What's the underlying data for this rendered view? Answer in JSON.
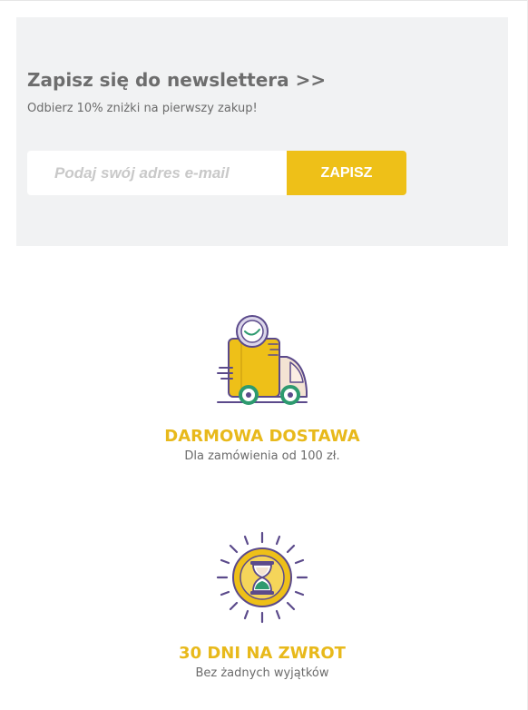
{
  "newsletter": {
    "title": "Zapisz się do newslettera >>",
    "subtitle": "Odbierz 10% zniżki na pierwszy zakup!",
    "email_placeholder": "Podaj swój adres e-mail",
    "email_value": "",
    "submit_label": "ZAPISZ"
  },
  "features": [
    {
      "icon": "delivery-truck-icon",
      "title": "DARMOWA DOSTAWA",
      "subtitle": "Dla zamówienia od 100 zł."
    },
    {
      "icon": "hourglass-icon",
      "title": "30 DNI NA ZWROT",
      "subtitle": "Bez żadnych wyjątków"
    }
  ],
  "colors": {
    "accent_yellow": "#eec018",
    "newsletter_background": "#f1f2f3",
    "icon_outline_purple": "#5b4a8b",
    "icon_green": "#2d9a6f",
    "text_gray": "#6b6b6b"
  }
}
